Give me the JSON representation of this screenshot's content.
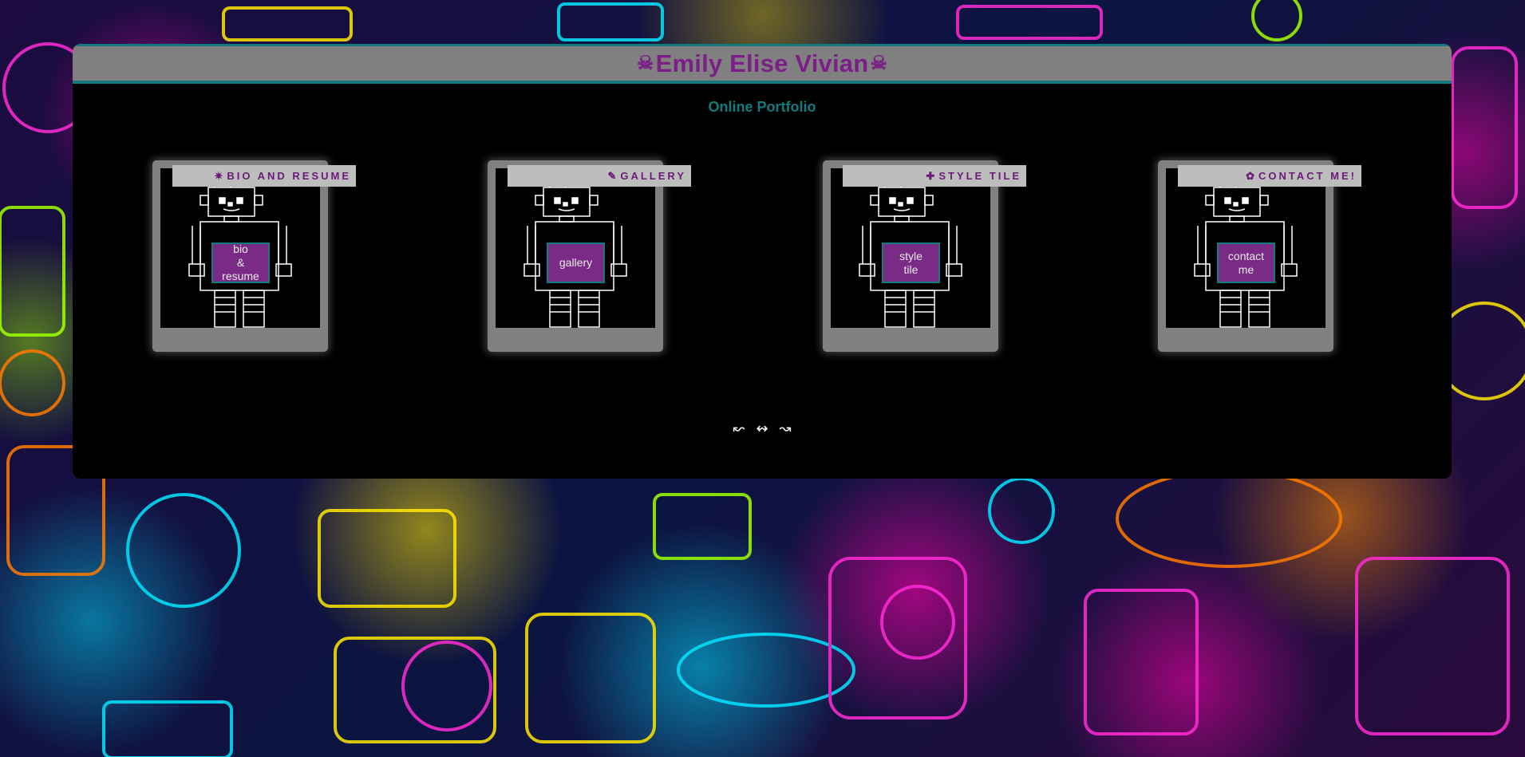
{
  "header": {
    "skull_left": "☠",
    "title": "Emily Elise Vivian",
    "skull_right": "☠"
  },
  "subtitle": "Online Portfolio",
  "cards": [
    {
      "tag_icon": "✷",
      "tag_label": "BIO AND RESUME",
      "sign_lines": [
        "bio",
        "&",
        "resume"
      ]
    },
    {
      "tag_icon": "✎",
      "tag_label": "GALLERY",
      "sign_lines": [
        "gallery"
      ]
    },
    {
      "tag_icon": "✚",
      "tag_label": "STYLE TILE",
      "sign_lines": [
        "style",
        "tile"
      ]
    },
    {
      "tag_icon": "✿",
      "tag_label": "CONTACT ME!",
      "sign_lines": [
        "contact",
        "me"
      ]
    }
  ],
  "pager": {
    "prev_glyph": "↜",
    "middle_glyph": "↭",
    "next_glyph": "↝"
  },
  "colors": {
    "title_purple": "#7a1f86",
    "teal": "#137a7d",
    "header_gray": "#808080",
    "sign_purple": "#7a2b86",
    "tag_gray": "#bdbdbd"
  }
}
